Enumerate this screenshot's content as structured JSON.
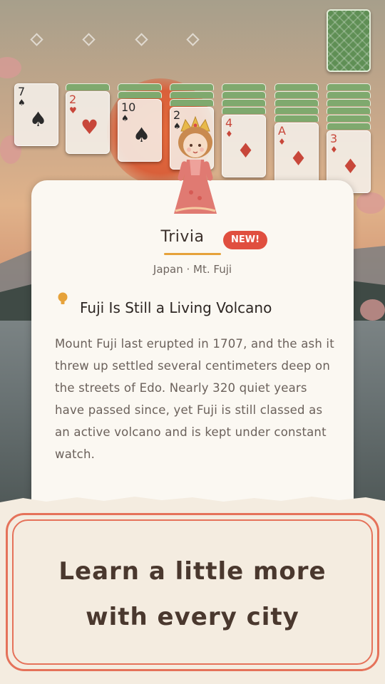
{
  "game": {
    "foundations": [
      {
        "icon": "diamond-outline-icon"
      },
      {
        "icon": "diamond-outline-icon"
      },
      {
        "icon": "diamond-outline-icon"
      },
      {
        "icon": "diamond-outline-icon"
      }
    ],
    "stock": {
      "icon": "card-back-icon"
    },
    "tableau": [
      {
        "hidden": 0,
        "rank": "7",
        "suit": "♠",
        "color": "#2a2a2a"
      },
      {
        "hidden": 1,
        "rank": "2",
        "suit": "♥",
        "color": "#c8473a"
      },
      {
        "hidden": 2,
        "rank": "10",
        "suit": "♠",
        "color": "#2a2a2a"
      },
      {
        "hidden": 3,
        "rank": "2",
        "suit": "♠",
        "color": "#2a2a2a"
      },
      {
        "hidden": 4,
        "rank": "4",
        "suit": "♦",
        "color": "#c8473a"
      },
      {
        "hidden": 5,
        "rank": "A",
        "suit": "♦",
        "color": "#c8473a"
      },
      {
        "hidden": 6,
        "rank": "3",
        "suit": "♦",
        "color": "#c8473a"
      }
    ]
  },
  "trivia": {
    "title": "Trivia",
    "badge": "NEW!",
    "location": "Japan · Mt. Fuji",
    "fact_title": "Fuji Is Still a Living Volcano",
    "fact_body": "Mount Fuji last erupted in 1707, and the ash it threw up settled several centimeters deep on the streets of Edo. Nearly 320 quiet years have passed since, yet Fuji is still classed as an active volcano and is kept under constant watch."
  },
  "banner": {
    "line1": "Learn a little more",
    "line2": "with every city"
  },
  "colors": {
    "accent_red": "#e04f3f",
    "underline": "#e6a23a",
    "frame": "#e5725a",
    "card_back": "#7fa96e"
  }
}
